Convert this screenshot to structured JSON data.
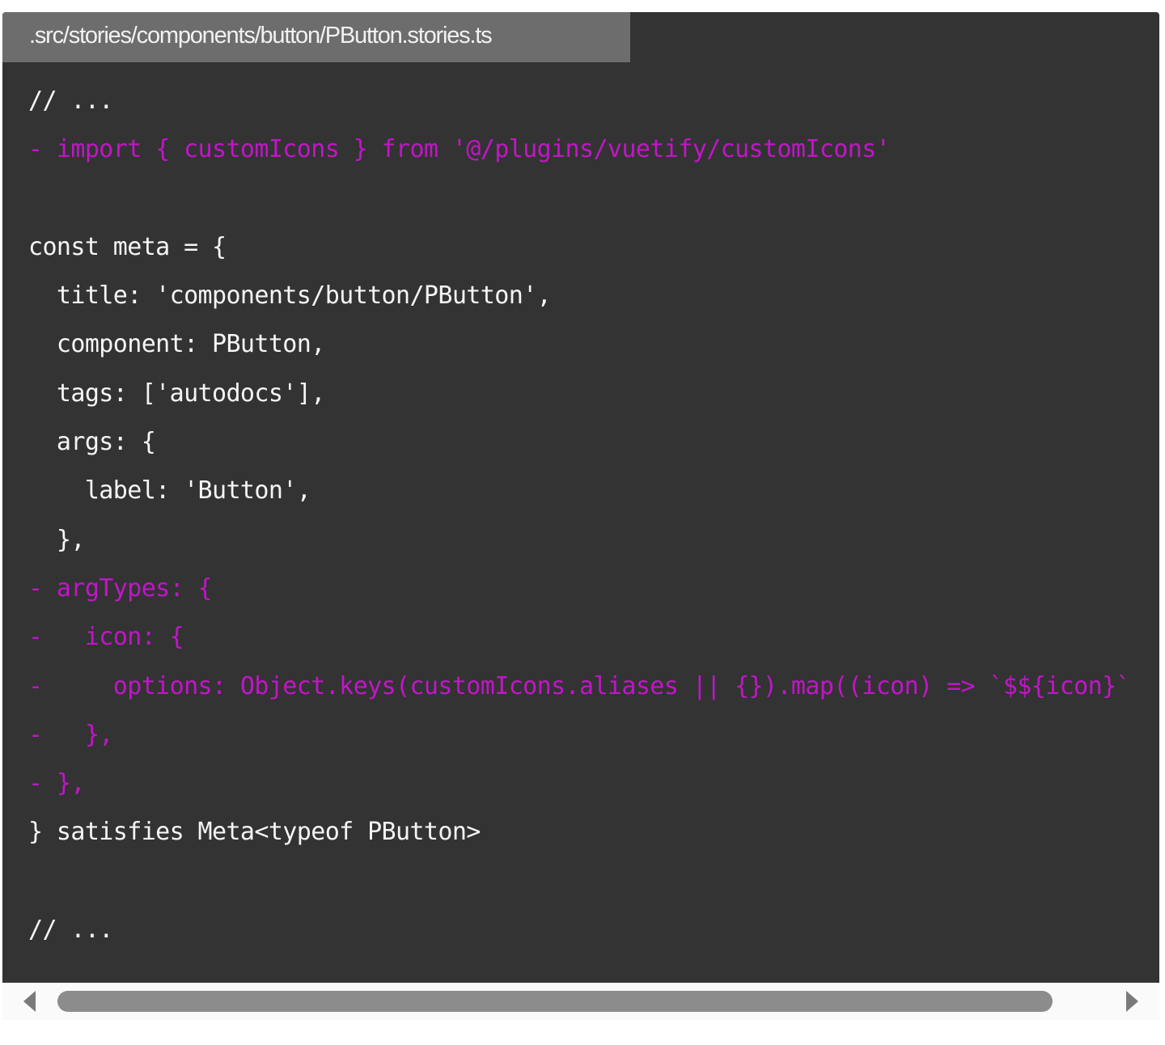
{
  "file_tab": {
    "label": ".src/stories/components/button/PButton.stories.ts"
  },
  "code": {
    "lines": [
      {
        "type": "normal",
        "text": "// ..."
      },
      {
        "type": "removed",
        "text": "- import { customIcons } from '@/plugins/vuetify/customIcons'"
      },
      {
        "type": "normal",
        "text": ""
      },
      {
        "type": "normal",
        "text": "const meta = {"
      },
      {
        "type": "normal",
        "text": "  title: 'components/button/PButton',"
      },
      {
        "type": "normal",
        "text": "  component: PButton,"
      },
      {
        "type": "normal",
        "text": "  tags: ['autodocs'],"
      },
      {
        "type": "normal",
        "text": "  args: {"
      },
      {
        "type": "normal",
        "text": "    label: 'Button',"
      },
      {
        "type": "normal",
        "text": "  },"
      },
      {
        "type": "removed",
        "text": "- argTypes: {"
      },
      {
        "type": "removed",
        "text": "-   icon: {"
      },
      {
        "type": "removed",
        "text": "-     options: Object.keys(customIcons.aliases || {}).map((icon) => `$${icon}`"
      },
      {
        "type": "removed",
        "text": "-   },"
      },
      {
        "type": "removed",
        "text": "- },"
      },
      {
        "type": "normal",
        "text": "} satisfies Meta<typeof PButton>"
      },
      {
        "type": "normal",
        "text": ""
      },
      {
        "type": "normal",
        "text": "// ..."
      }
    ]
  },
  "colors": {
    "background": "#333333",
    "tab_background": "#6d6d6d",
    "normal_text": "#f5f5f5",
    "removed_text": "#c215c8",
    "scroll_thumb": "#8c8c8c"
  },
  "icons": {
    "scroll_left": "triangle-left",
    "scroll_right": "triangle-right"
  }
}
